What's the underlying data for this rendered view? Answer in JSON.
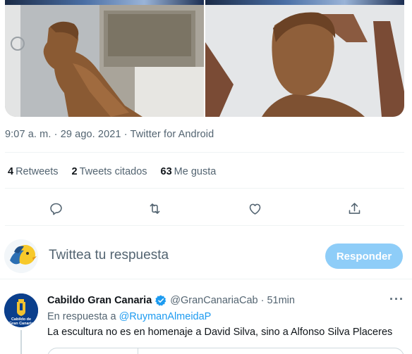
{
  "tweet": {
    "time": "9:07 a. m.",
    "date": "29 ago. 2021",
    "source": "Twitter for Android",
    "separator": "·",
    "stats": {
      "retweets_count": "4",
      "retweets_label": "Retweets",
      "quotes_count": "2",
      "quotes_label": "Tweets citados",
      "likes_count": "63",
      "likes_label": "Me gusta"
    },
    "actions": [
      "reply-icon",
      "retweet-icon",
      "like-icon",
      "share-icon"
    ]
  },
  "compose": {
    "placeholder": "Twittea tu respuesta",
    "button_label": "Responder"
  },
  "reply": {
    "name": "Cabildo Gran Canaria",
    "handle": "@GranCanariaCab",
    "separator": "·",
    "time": "51min",
    "in_reply_prefix": "En respuesta a",
    "in_reply_handle": "@RuymanAlmeidaP",
    "text": "La escultura no es en homenaje a David Silva, sino a Alfonso Silva Placeres",
    "avatar_text_1": "Cabildo de",
    "avatar_text_2": "Gran Canaria"
  },
  "colors": {
    "accent": "#1d9bf0",
    "button_disabled": "#8ecdf8",
    "muted_text": "#536471",
    "verified": "#1d9bf0"
  }
}
